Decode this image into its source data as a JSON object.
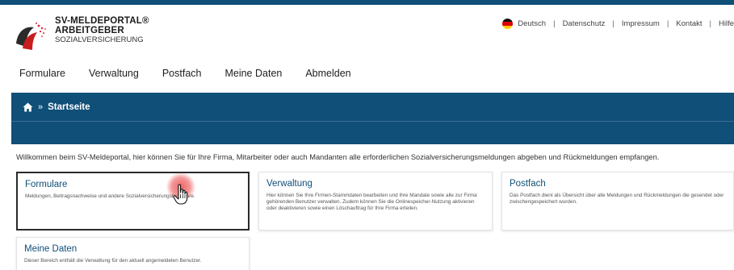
{
  "logo": {
    "line1": "SV-MELDEPORTAL®",
    "line2": "ARBEITGEBER",
    "line3": "SOZIALVERSICHERUNG",
    "icon": "sv-logo-mark"
  },
  "utility_nav": {
    "language": "Deutsch",
    "flag_icon": "germany-flag-icon",
    "links": [
      "Datenschutz",
      "Impressum",
      "Kontakt",
      "Hilfe"
    ],
    "separator": "|"
  },
  "main_nav": {
    "items": [
      "Formulare",
      "Verwaltung",
      "Postfach",
      "Meine Daten",
      "Abmelden"
    ]
  },
  "breadcrumb": {
    "home_icon": "home-icon",
    "arrow": "»",
    "current": "Startseite"
  },
  "welcome_text": "Willkommen beim SV-Meldeportal, hier können Sie für Ihre Firma, Mitarbeiter oder auch Mandanten alle erforderlichen Sozialversicherungsmeldungen abgeben und Rückmeldungen empfangen.",
  "cards": [
    {
      "title": "Formulare",
      "description": "Meldungen, Beitragsnachweise und andere Sozialversicherungsformulare."
    },
    {
      "title": "Verwaltung",
      "description": "Hier können Sie Ihre Firmen-Stammdaten bearbeiten und Ihre Mandate sowie alle zur Firma gehörenden Benutzer verwalten. Zudem können Sie die Onlinespeicher-Nutzung aktivieren oder deaktivieren sowie einen Löschauftrag für Ihre Firma erteilen."
    },
    {
      "title": "Postfach",
      "description": "Das Postfach dient als Übersicht über alle Meldungen und Rückmeldungen die gesendet oder zwischengespeichert wurden."
    },
    {
      "title": "Meine Daten",
      "description": "Dieser Bereich enthält die Verwaltung für den aktuell angemeldeten Benutzer."
    }
  ],
  "colors": {
    "brand_blue": "#0f4f78",
    "highlight_red": "#eb4646"
  }
}
